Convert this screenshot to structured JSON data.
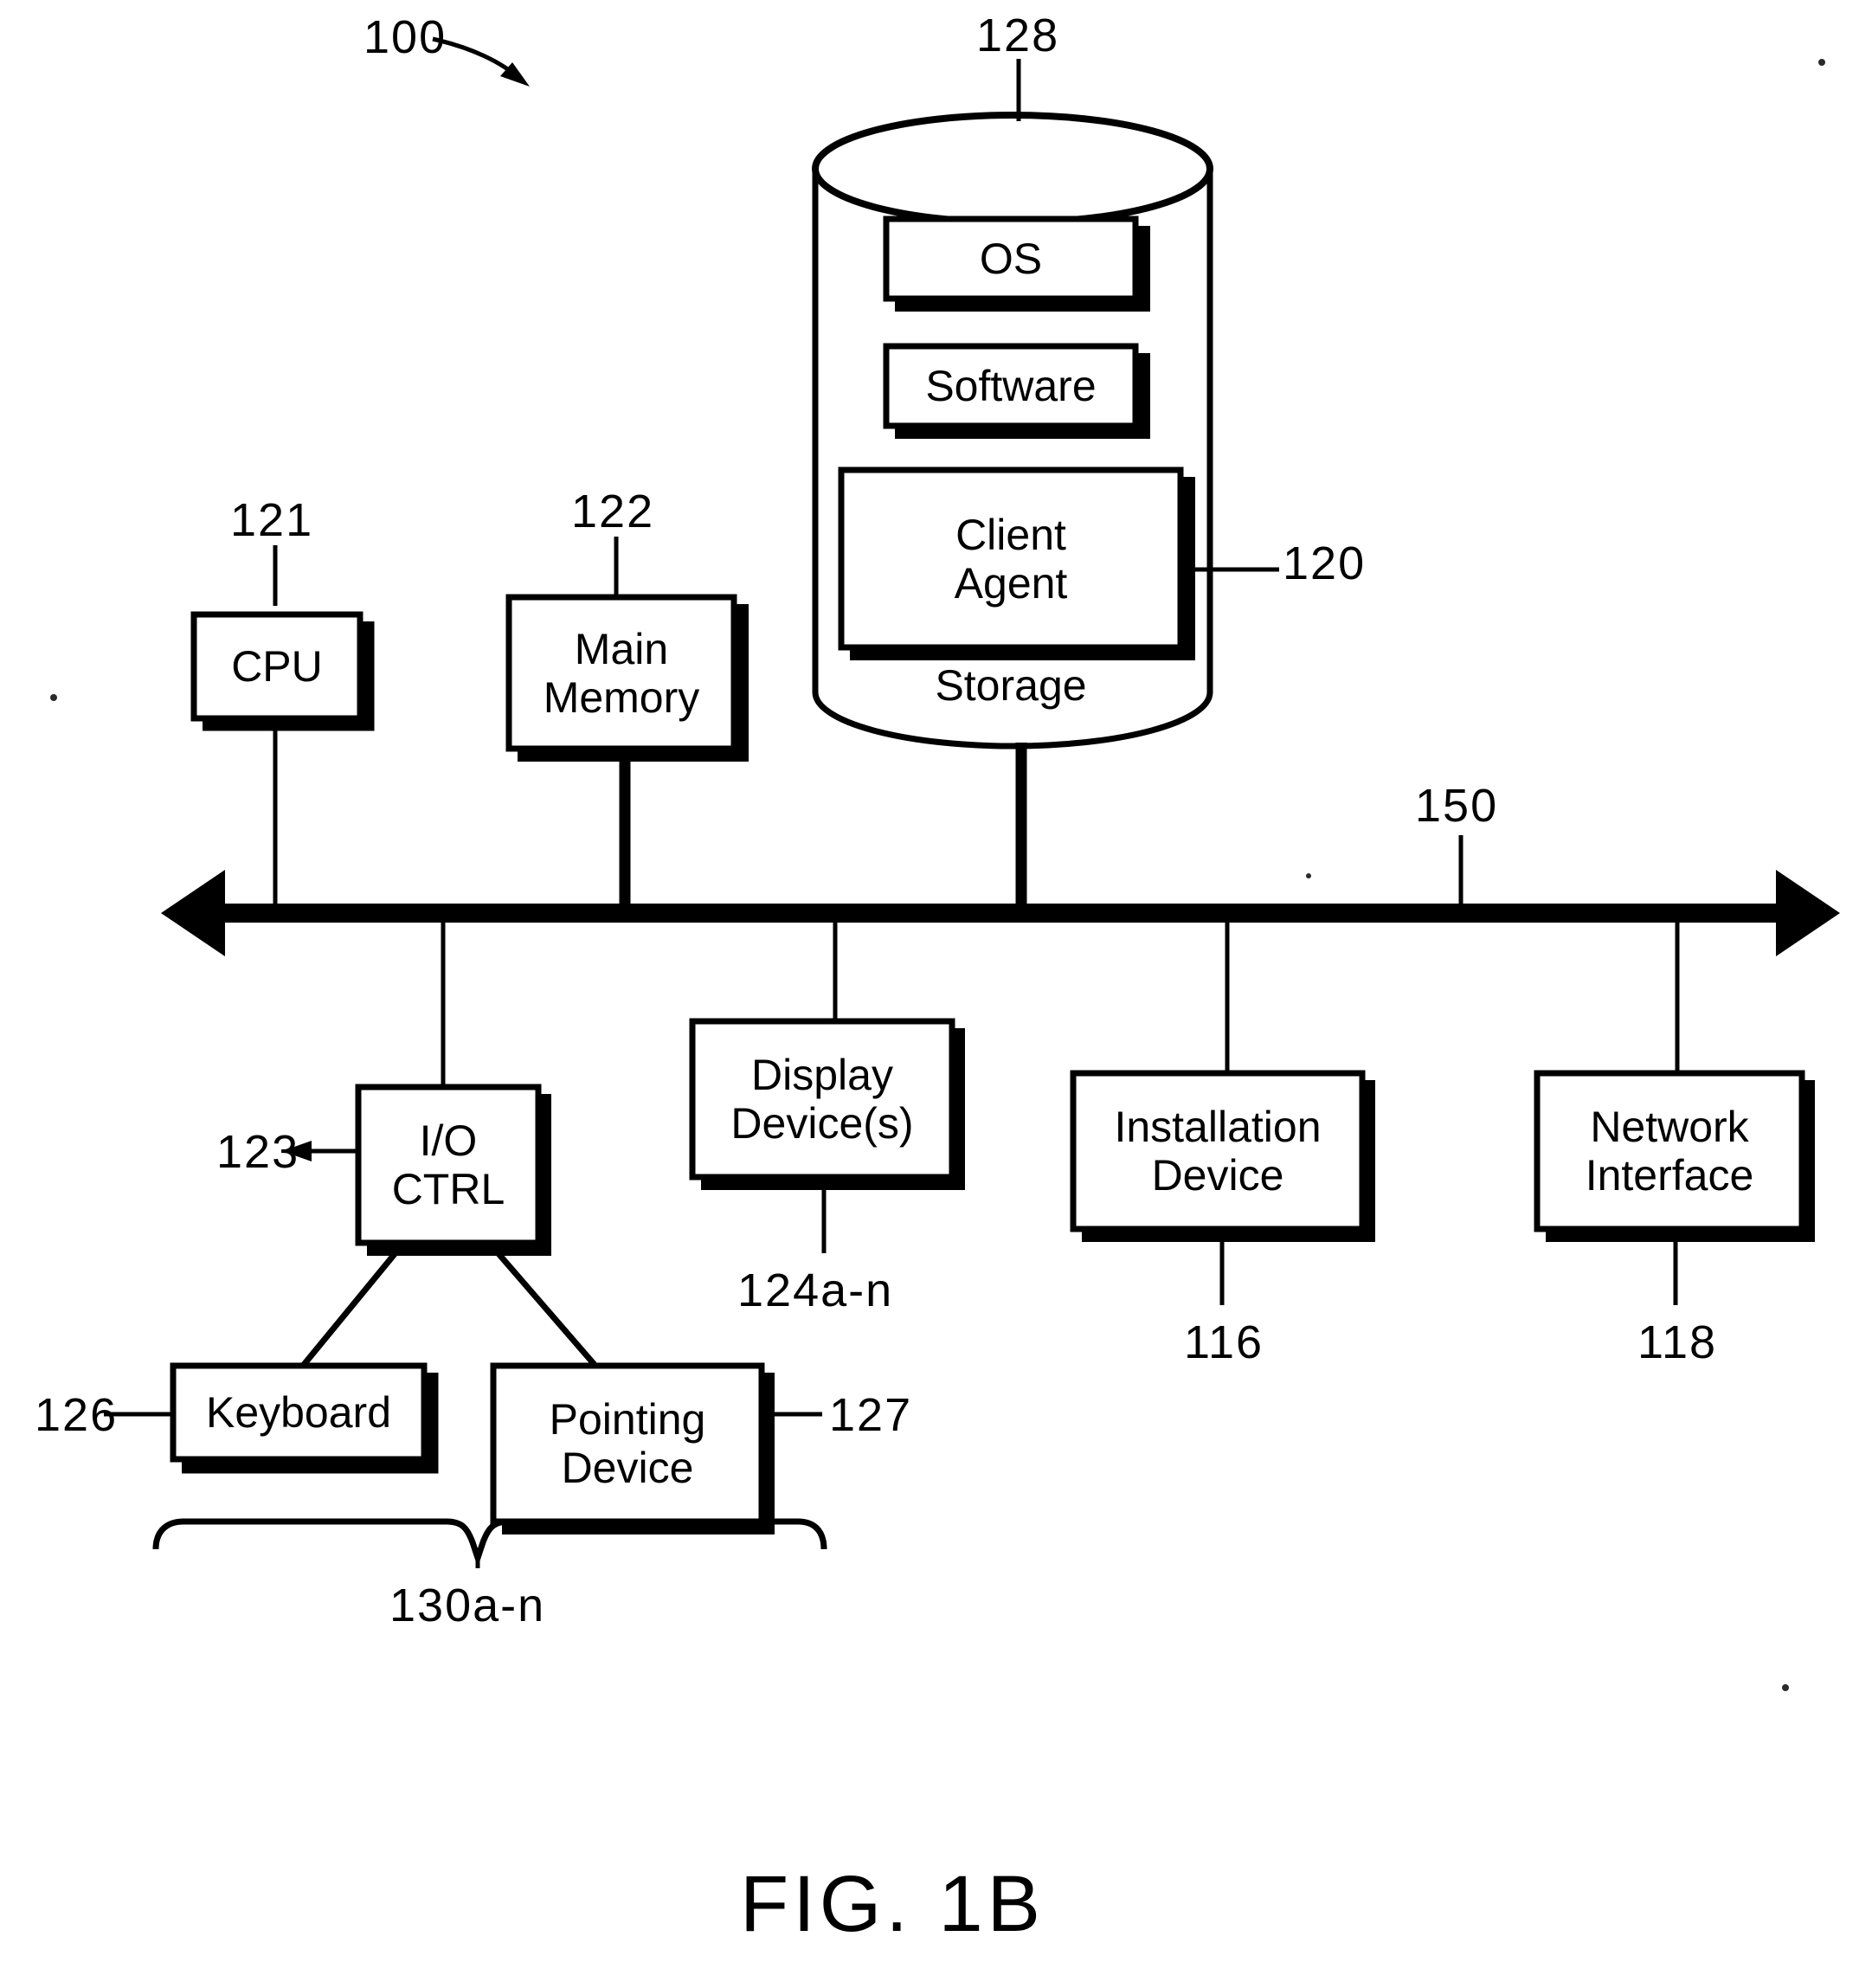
{
  "figure": {
    "caption": "FIG. 1B",
    "system_ref": "100"
  },
  "bus": {
    "label": "150"
  },
  "storage": {
    "cylinder_ref": "128",
    "storage_label": "Storage",
    "items": [
      {
        "label": "OS"
      },
      {
        "label": "Software"
      },
      {
        "label": "Client\nAgent",
        "ref": "120"
      }
    ]
  },
  "components_above_bus": [
    {
      "label": "CPU",
      "ref": "121"
    },
    {
      "label": "Main\nMemory",
      "ref": "122"
    }
  ],
  "components_below_bus": [
    {
      "label": "I/O\nCTRL",
      "ref": "123"
    },
    {
      "label": "Display\nDevice(s)",
      "ref": "124a-n"
    },
    {
      "label": "Installation\nDevice",
      "ref": "116"
    },
    {
      "label": "Network\nInterface",
      "ref": "118"
    }
  ],
  "io_devices": {
    "group_ref": "130a-n",
    "items": [
      {
        "label": "Keyboard",
        "ref": "126"
      },
      {
        "label": "Pointing\nDevice",
        "ref": "127"
      }
    ]
  }
}
